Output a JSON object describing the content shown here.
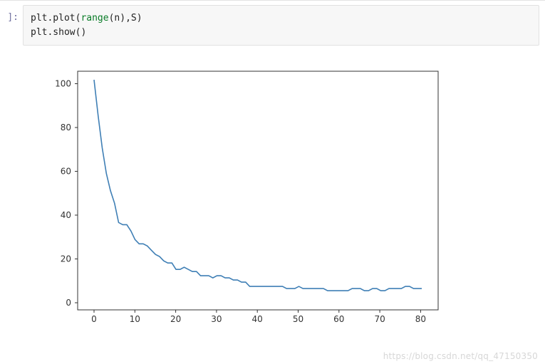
{
  "code_cell": {
    "prompt": "]:",
    "lines": [
      {
        "a": "plt.plot(",
        "b": "range",
        "c": "(n),S)"
      },
      {
        "a": "plt.show()"
      }
    ]
  },
  "watermark": "https://blog.csdn.net/qq_47150350",
  "chart_data": {
    "type": "line",
    "xlabel": "",
    "ylabel": "",
    "title": "",
    "xlim": [
      -4,
      84
    ],
    "ylim": [
      -6,
      106
    ],
    "xticks": [
      0,
      10,
      20,
      30,
      40,
      50,
      60,
      70,
      80
    ],
    "yticks": [
      0,
      20,
      40,
      60,
      80,
      100
    ],
    "line_color": "#3f7fb5",
    "x": [
      0,
      1,
      2,
      3,
      4,
      5,
      6,
      7,
      8,
      9,
      10,
      11,
      12,
      13,
      14,
      15,
      16,
      17,
      18,
      19,
      20,
      21,
      22,
      23,
      24,
      25,
      26,
      27,
      28,
      29,
      30,
      31,
      32,
      33,
      34,
      35,
      36,
      37,
      38,
      39,
      40,
      41,
      42,
      43,
      44,
      45,
      46,
      47,
      48,
      49,
      50,
      51,
      52,
      53,
      54,
      55,
      56,
      57,
      58,
      59,
      60,
      61,
      62,
      63,
      64,
      65,
      66,
      67,
      68,
      69,
      70,
      71,
      72,
      73,
      74,
      75,
      76,
      77,
      78,
      79,
      80
    ],
    "values": [
      102,
      85,
      70,
      58,
      50,
      44,
      35,
      34,
      34,
      31,
      27,
      25,
      25,
      24,
      22,
      20,
      19,
      17,
      16,
      16,
      13,
      13,
      14,
      13,
      12,
      12,
      10,
      10,
      10,
      9,
      10,
      10,
      9,
      9,
      8,
      8,
      7,
      7,
      5,
      5,
      5,
      5,
      5,
      5,
      5,
      5,
      5,
      4,
      4,
      4,
      5,
      4,
      4,
      4,
      4,
      4,
      4,
      3,
      3,
      3,
      3,
      3,
      3,
      4,
      4,
      4,
      3,
      3,
      4,
      4,
      3,
      3,
      4,
      4,
      4,
      4,
      5,
      5,
      4,
      4,
      4
    ]
  }
}
